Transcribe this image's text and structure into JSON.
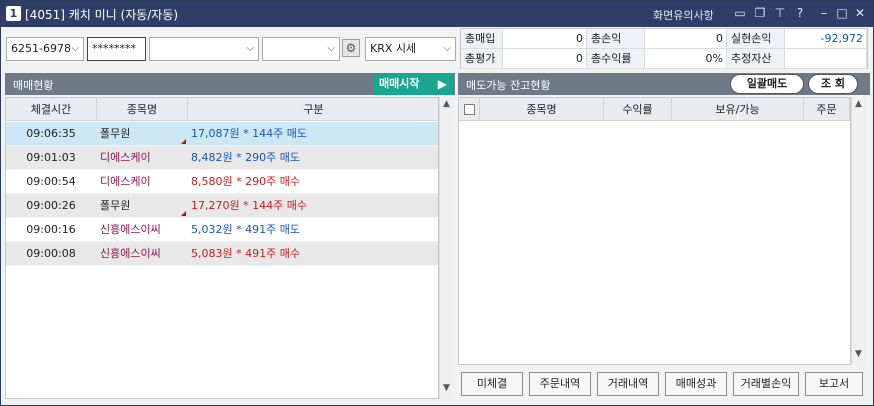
{
  "titlebar": {
    "screen_no": "1",
    "title": "[4051] 캐치 미니 (자동/자동)",
    "notice": "화면유의사항",
    "icons": [
      "window-icon",
      "restore-icon",
      "pin-icon",
      "help-icon",
      "minimize-icon",
      "maximize-icon",
      "close-icon"
    ]
  },
  "toolbar": {
    "account": "6251-6978",
    "password": "********",
    "select2": "",
    "select3": "",
    "price_source": "KRX 시세"
  },
  "summary": {
    "labels": {
      "total_buy": "총매입",
      "total_pl": "총손익",
      "realized_pl": "실현손익",
      "total_eval": "총평가",
      "total_return": "총수익률",
      "est_asset": "추정자산"
    },
    "values": {
      "total_buy": "0",
      "total_pl": "0",
      "realized_pl": "-92,972",
      "total_eval": "0",
      "total_return": "0%",
      "est_asset": ""
    }
  },
  "left_panel": {
    "title": "매매현황",
    "start_button": "매매시작",
    "columns": [
      "체결시간",
      "종목명",
      "구분"
    ],
    "rows": [
      {
        "time": "09:06:35",
        "name": "폴무원",
        "detail": "17,087원 * 144주 매도",
        "side": "sell",
        "selected": true
      },
      {
        "time": "09:01:03",
        "name": "디에스케이",
        "detail": "8,482원 * 290주 매도",
        "side": "sell",
        "selected": false
      },
      {
        "time": "09:00:54",
        "name": "디에스케이",
        "detail": "8,580원 * 290주 매수",
        "side": "buy",
        "selected": false
      },
      {
        "time": "09:00:26",
        "name": "폴무원",
        "detail": "17,270원 * 144주 매수",
        "side": "buy",
        "selected": false
      },
      {
        "time": "09:00:16",
        "name": "신흥에스이씨",
        "detail": "5,032원 * 491주 매도",
        "side": "sell",
        "selected": false
      },
      {
        "time": "09:00:08",
        "name": "신흥에스이씨",
        "detail": "5,083원 * 491주 매수",
        "side": "buy",
        "selected": false
      }
    ]
  },
  "right_panel": {
    "title": "매도가능 잔고현황",
    "bulk_sell_button": "일괄매도",
    "query_button": "조 회",
    "columns": [
      "종목명",
      "수익률",
      "보유/가능",
      "주문"
    ],
    "buttons": [
      "미체결",
      "주문내역",
      "거래내역",
      "매매성과",
      "거래별손익",
      "보고서"
    ]
  },
  "colors": {
    "title_bg": "#2e3e66",
    "panel_header": "#6f7a87",
    "start_button": "#1aa58e",
    "sell_text": "#1a55b4",
    "buy_text": "#cc1b1b",
    "selected_row": "#cde8f4",
    "alt_row": "#e8e8e8"
  }
}
